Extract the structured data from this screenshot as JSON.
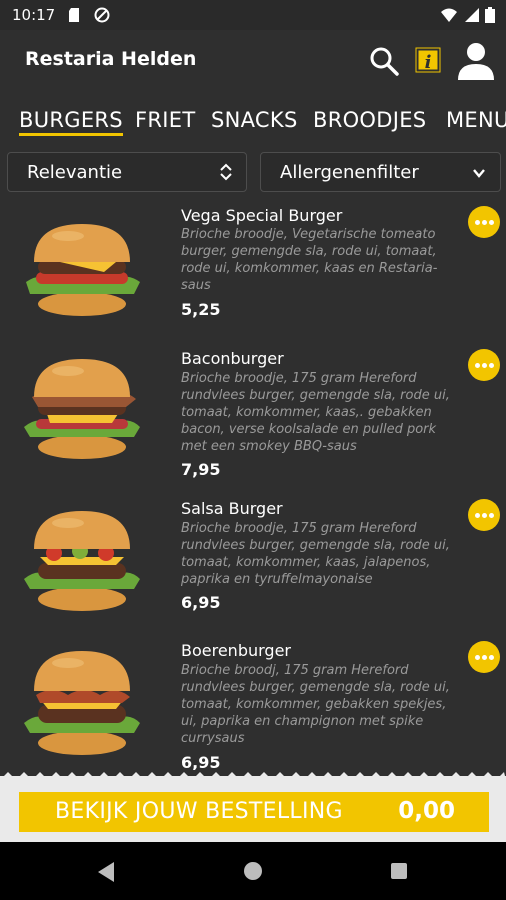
{
  "status_bar": {
    "time": "10:17",
    "icons": [
      "sd-card-icon",
      "sync-icon",
      "wifi-icon",
      "signal-icon",
      "battery-icon"
    ]
  },
  "header": {
    "title": "Restaria Helden",
    "icons": [
      "search-icon",
      "info-icon",
      "user-icon"
    ]
  },
  "tabs": [
    {
      "label": "BURGERS",
      "active": true
    },
    {
      "label": "FRIET",
      "active": false
    },
    {
      "label": "SNACKS",
      "active": false
    },
    {
      "label": "BROODJES",
      "active": false
    },
    {
      "label": "MENU",
      "active": false
    }
  ],
  "filters": {
    "sort": {
      "label": "Relevantie",
      "icon": "sort-arrows-icon"
    },
    "allergen": {
      "label": "Allergenenfilter",
      "icon": "chevron-down-icon"
    }
  },
  "products": [
    {
      "name": "Vega Special Burger",
      "description_lines": [
        "Brioche broodje, Vegetarische tomeato",
        "burger, gemengde sla, rode ui, tomaat,",
        "rode ui, komkommer, kaas en Restaria-",
        "saus"
      ],
      "price": "5,25"
    },
    {
      "name": "Baconburger",
      "description_lines": [
        "Brioche broodje, 175 gram Hereford",
        "rundvlees burger, gemengde sla, rode ui,",
        "tomaat, komkommer, kaas,. gebakken",
        "bacon, verse koolsalade en pulled pork",
        "met een smokey BBQ-saus"
      ],
      "price": "7,95"
    },
    {
      "name": "Salsa Burger",
      "description_lines": [
        "Brioche broodje, 175 gram Hereford",
        "rundvlees burger, gemengde sla, rode ui,",
        "tomaat, komkommer, kaas, jalapenos,",
        "paprika en tyruffelmayonaise"
      ],
      "price": "6,95"
    },
    {
      "name": "Boerenburger",
      "description_lines": [
        "Brioche broodj, 175 gram Hereford",
        "rundvlees burger, gemengde sla, rode ui,",
        "tomaat, komkommer, gebakken spekjes,",
        "ui, paprika en champignon met spike",
        "currysaus"
      ],
      "price": "6,95"
    }
  ],
  "order_bar": {
    "label": "BEKIJK JOUW BESTELLING",
    "amount": "0,00"
  },
  "colors": {
    "accent": "#f2c500",
    "background": "#2f2f2f",
    "muted_text": "#9a9a9a"
  }
}
